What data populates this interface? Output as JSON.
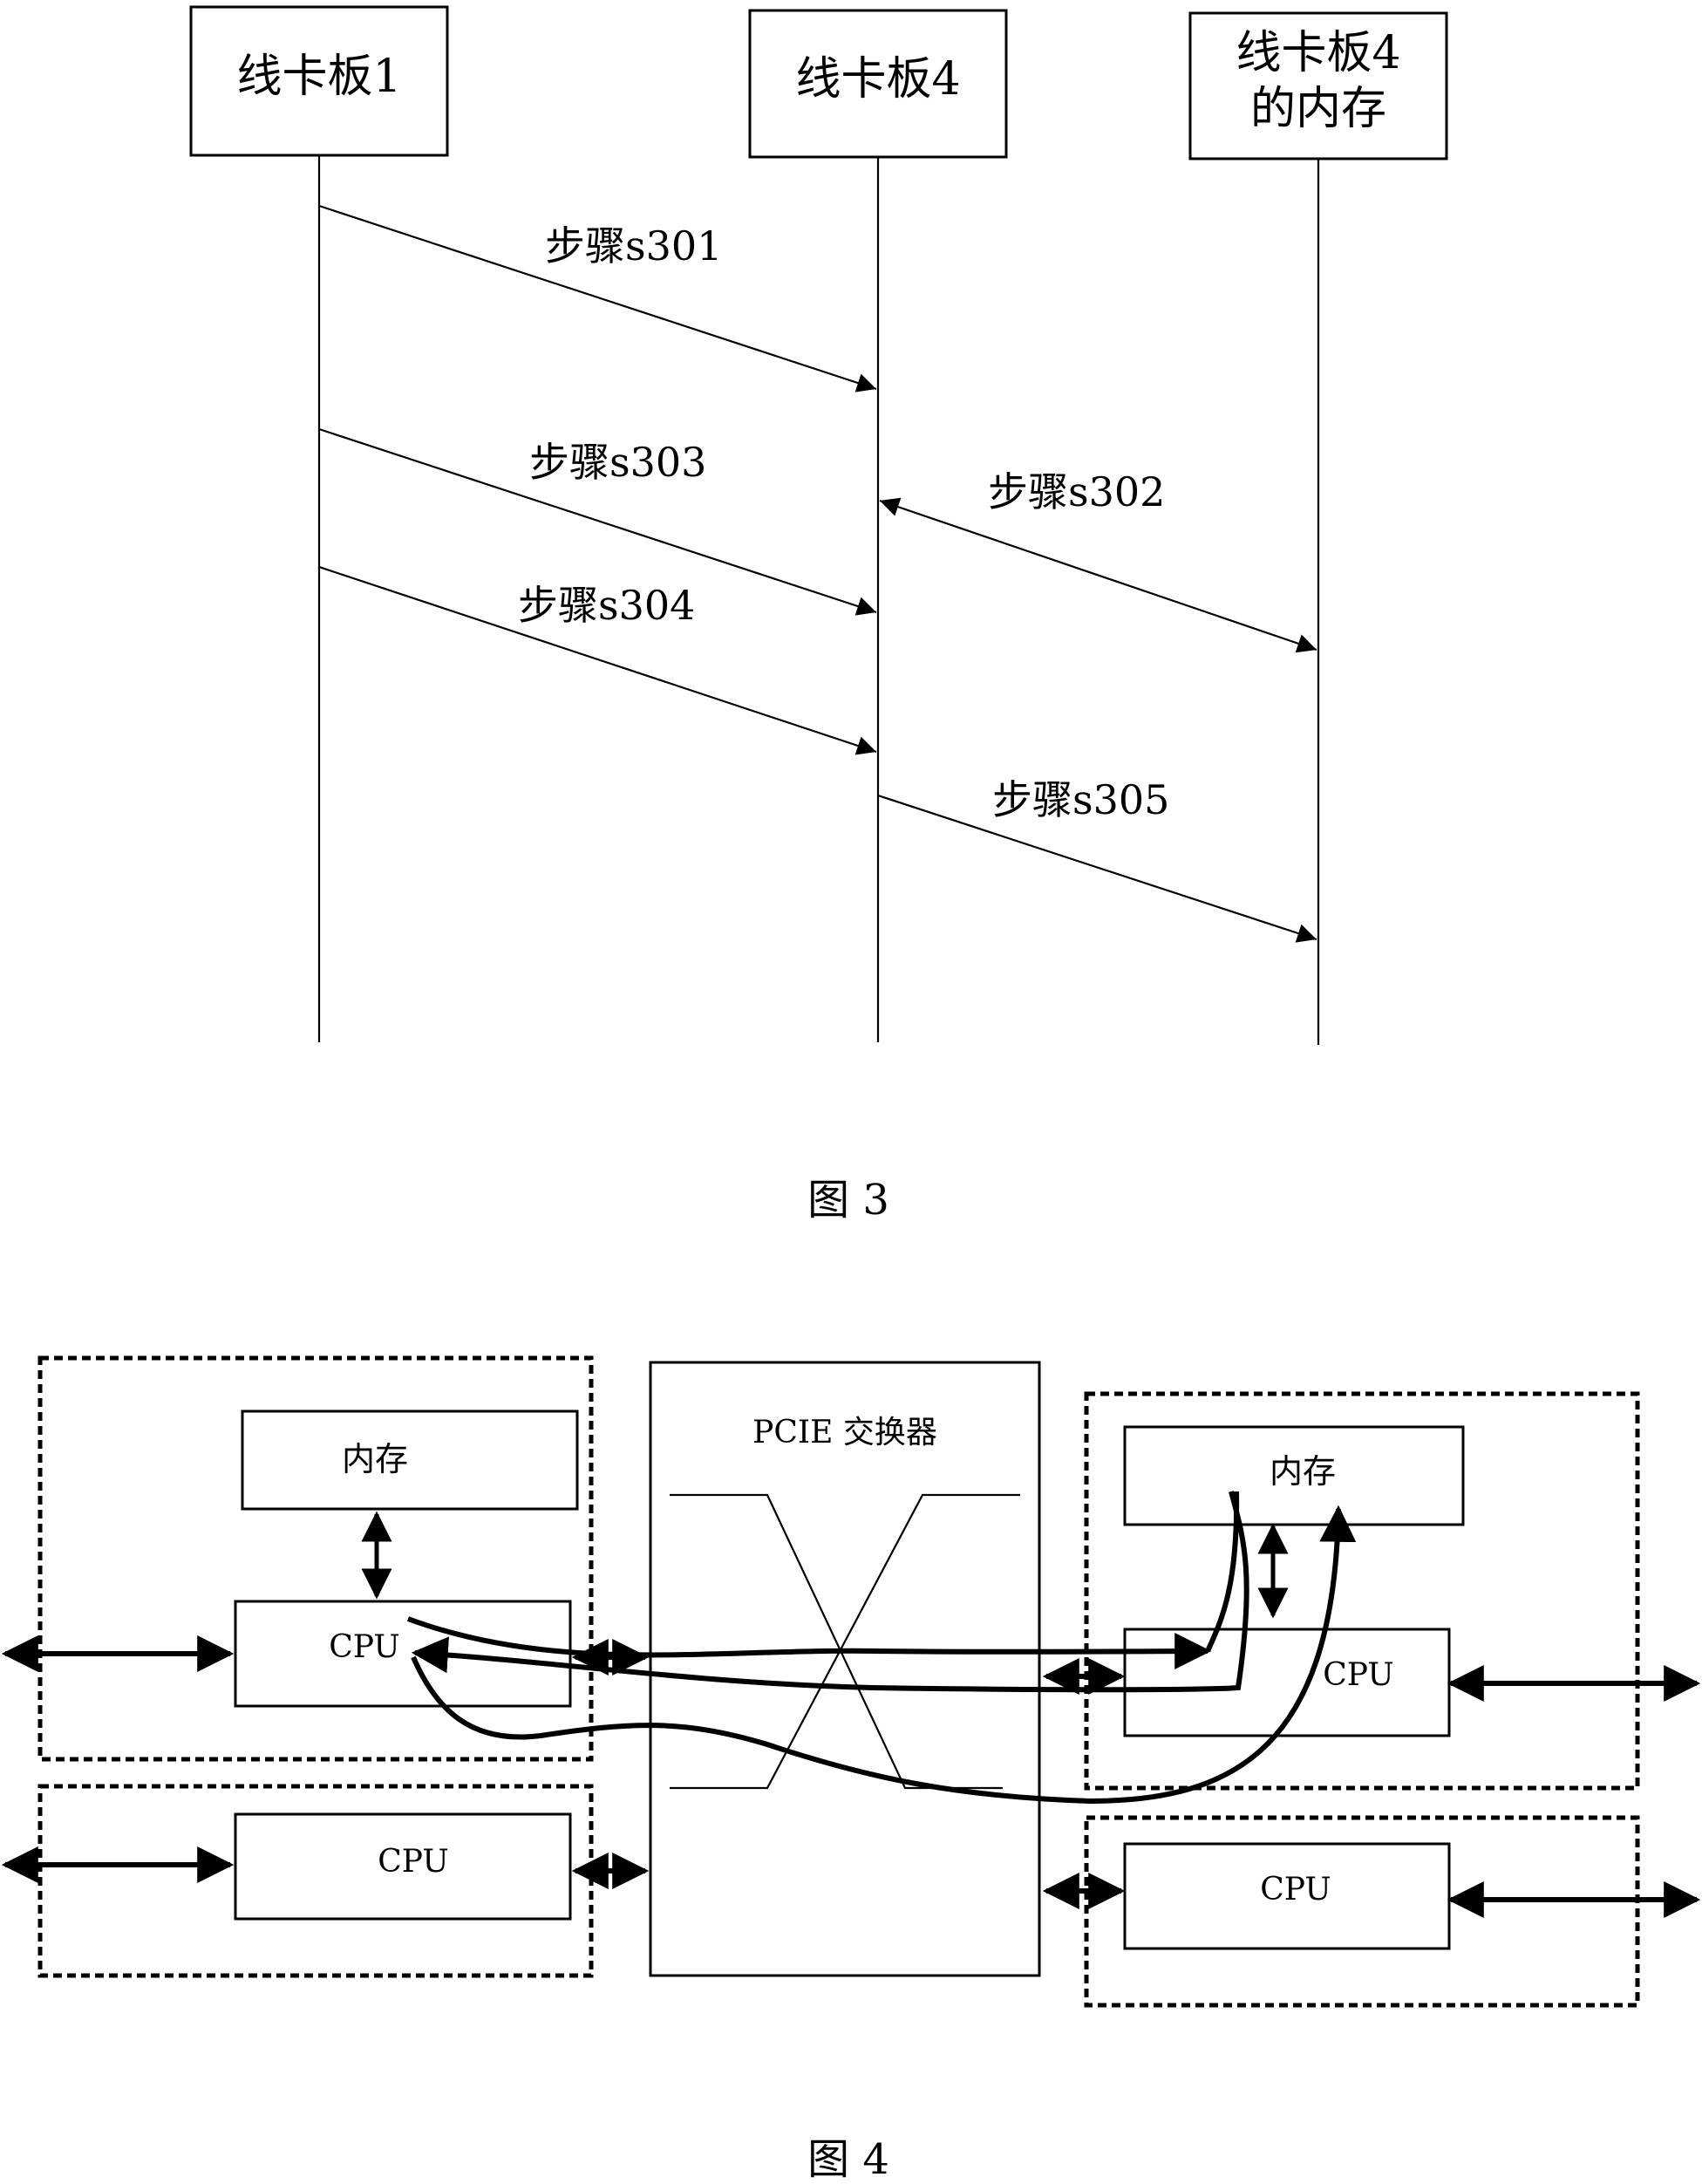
{
  "figure3": {
    "caption": "图 3",
    "participants": [
      {
        "id": "lc1",
        "lines": [
          "线卡板1"
        ]
      },
      {
        "id": "lc4",
        "lines": [
          "线卡板4"
        ]
      },
      {
        "id": "mem4",
        "lines": [
          "线卡板4",
          "的内存"
        ]
      }
    ],
    "messages": [
      {
        "label": "步骤s301",
        "from": "lc1",
        "to": "lc4"
      },
      {
        "label": "步骤s302",
        "from": "lc4",
        "to": "mem4",
        "bidirectional": true
      },
      {
        "label": "步骤s303",
        "from": "lc1",
        "to": "lc4"
      },
      {
        "label": "步骤s304",
        "from": "lc1",
        "to": "lc4"
      },
      {
        "label": "步骤s305",
        "from": "lc4",
        "to": "mem4"
      }
    ]
  },
  "figure4": {
    "caption": "图 4",
    "switch_label": "PCIE 交换器",
    "left_top": {
      "memory": "内存",
      "cpu": "CPU"
    },
    "left_bottom": {
      "cpu": "CPU"
    },
    "right_top": {
      "memory": "内存",
      "cpu": "CPU"
    },
    "right_bottom": {
      "cpu": "CPU"
    }
  }
}
